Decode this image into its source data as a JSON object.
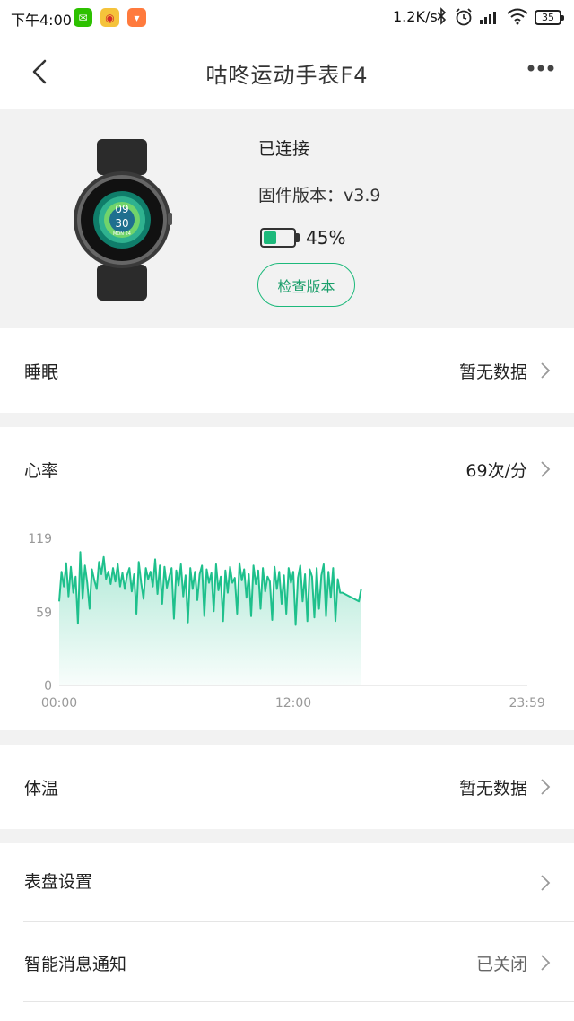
{
  "status_bar": {
    "time": "下午4:00",
    "network_speed": "1.2K/s",
    "battery": "35",
    "app_icons": [
      "wechat-icon",
      "weibo-icon",
      "mi-icon"
    ]
  },
  "header": {
    "title": "咕咚运动手表F4",
    "back_icon": "back-arrow-icon",
    "more_icon": "more-dots-icon"
  },
  "device": {
    "status": "已连接",
    "firmware": "固件版本：v3.9",
    "battery_percent": 45,
    "battery_label": "45%",
    "check_button": "检查版本",
    "watch_face": {
      "hour": "09",
      "minute": "30",
      "date": "MON 24"
    }
  },
  "sleep": {
    "label": "睡眠",
    "value": "暂无数据"
  },
  "heart_rate": {
    "label": "心率",
    "value": "69次/分"
  },
  "temperature": {
    "label": "体温",
    "value": "暂无数据"
  },
  "watch_face_settings": {
    "label": "表盘设置"
  },
  "notifications": {
    "label": "智能消息通知",
    "value": "已关闭"
  },
  "colors": {
    "accent": "#1db97b",
    "chart_line": "#1ec08c",
    "background": "#f2f2f2"
  },
  "chart_data": {
    "type": "area",
    "title": "",
    "xlabel": "",
    "ylabel": "",
    "x_range_hours": [
      0,
      24
    ],
    "ylim": [
      0,
      119
    ],
    "yticks": [
      "119",
      "59",
      "0"
    ],
    "xticks": [
      "00:00",
      "12:00",
      "23:59"
    ],
    "grid": false,
    "series": [
      {
        "values_hours": [
          0,
          0.12,
          0.24,
          0.36,
          0.48,
          0.6,
          0.72,
          0.84,
          0.96,
          1.08,
          1.2,
          1.32,
          1.44,
          1.56,
          1.68,
          1.8,
          1.92,
          2.04,
          2.16,
          2.28,
          2.4,
          2.52,
          2.64,
          2.76,
          2.88,
          3.0,
          3.12,
          3.24,
          3.36,
          3.48,
          3.6,
          3.72,
          3.84,
          3.96,
          4.08,
          4.2,
          4.32,
          4.44,
          4.56,
          4.68,
          4.8,
          4.92,
          5.04,
          5.16,
          5.28,
          5.4,
          5.52,
          5.64,
          5.76,
          5.88,
          6.0,
          6.12,
          6.24,
          6.36,
          6.48,
          6.6,
          6.72,
          6.84,
          6.96,
          7.08,
          7.2,
          7.32,
          7.44,
          7.56,
          7.68,
          7.8,
          7.92,
          8.04,
          8.16,
          8.28,
          8.4,
          8.52,
          8.64,
          8.76,
          8.88,
          9.0,
          9.12,
          9.24,
          9.36,
          9.48,
          9.6,
          9.72,
          9.84,
          9.96,
          10.08,
          10.2,
          10.32,
          10.44,
          10.56,
          10.68,
          10.8,
          10.92,
          11.04,
          11.16,
          11.28,
          11.4,
          11.52,
          11.64,
          11.76,
          11.88,
          12.0,
          12.12,
          12.24,
          12.36,
          12.48,
          12.6,
          12.72,
          12.84,
          12.96,
          13.08,
          13.2,
          13.32,
          13.44,
          13.56,
          13.68,
          13.8,
          13.92,
          14.04,
          14.16,
          14.28,
          14.4,
          14.52,
          14.64,
          14.76,
          14.88,
          15.0,
          15.12,
          15.24,
          15.36,
          15.48
        ],
        "values_bpm": [
          68,
          92,
          80,
          99,
          72,
          96,
          75,
          88,
          50,
          108,
          70,
          97,
          83,
          62,
          94,
          85,
          78,
          100,
          90,
          104,
          86,
          92,
          82,
          95,
          84,
          98,
          80,
          91,
          78,
          89,
          95,
          76,
          90,
          58,
          100,
          83,
          70,
          95,
          86,
          92,
          80,
          102,
          74,
          97,
          66,
          96,
          79,
          88,
          95,
          54,
          93,
          81,
          98,
          72,
          89,
          51,
          95,
          78,
          92,
          69,
          90,
          97,
          56,
          94,
          83,
          91,
          60,
          98,
          77,
          88,
          52,
          93,
          75,
          96,
          83,
          87,
          58,
          99,
          85,
          94,
          71,
          90,
          56,
          97,
          82,
          93,
          62,
          95,
          76,
          88,
          84,
          53,
          96,
          78,
          92,
          66,
          89,
          58,
          95,
          83,
          92,
          49,
          87,
          97,
          68,
          90,
          52,
          94,
          88,
          55,
          95,
          62,
          89,
          98,
          56,
          92,
          71,
          95,
          52,
          86,
          75,
          75,
          74,
          73,
          72,
          71,
          70,
          69,
          68,
          78,
          68
        ]
      }
    ]
  }
}
